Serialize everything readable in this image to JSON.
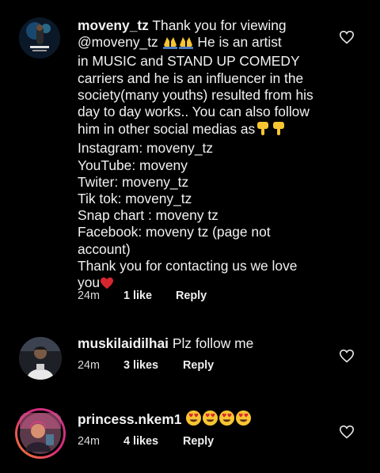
{
  "comments": [
    {
      "username": "moveny_tz",
      "text_lines": [
        " Thank you for viewing",
        "@moveny_tz ",
        "in MUSIC and STAND UP COMEDY",
        "carriers and he is an influencer in the",
        "society(many youths) resulted from his",
        "day to day works.. You can also follow",
        "him in other social medias as",
        "Instagram: moveny_tz",
        "YouTube: moveny",
        "Twiter: moveny_tz",
        "Tik tok: moveny_tz",
        "Snap chart : moveny tz",
        "Facebook: moveny tz (page not",
        "account)",
        "Thank you for contacting us we love",
        "you"
      ],
      "line2_tail": " He is an artist",
      "time": "24m",
      "likes": "1 like",
      "reply": "Reply",
      "avatar_icon": "artist-portrait-avatar",
      "emojis": [
        "folded-hands",
        "folded-hands",
        "pointing-down",
        "pointing-down",
        "red-heart"
      ]
    },
    {
      "username": "muskilaidilhai",
      "text": " Plz follow me",
      "time": "24m",
      "likes": "3 likes",
      "reply": "Reply",
      "avatar_icon": "man-portrait-avatar"
    },
    {
      "username": "princess.nkem1",
      "text": " ",
      "time": "24m",
      "likes": "4 likes",
      "reply": "Reply",
      "avatar_icon": "story-ring-avatar",
      "emojis": [
        "heart-eyes",
        "heart-eyes",
        "heart-eyes",
        "heart-eyes"
      ]
    }
  ],
  "colors": {
    "background": "#000000",
    "text": "#f2f2f2",
    "emoji_yellow": "#f7c531",
    "heart_red": "#d8262f",
    "story_ring_start": "#c13584",
    "story_ring_end": "#f58529"
  }
}
